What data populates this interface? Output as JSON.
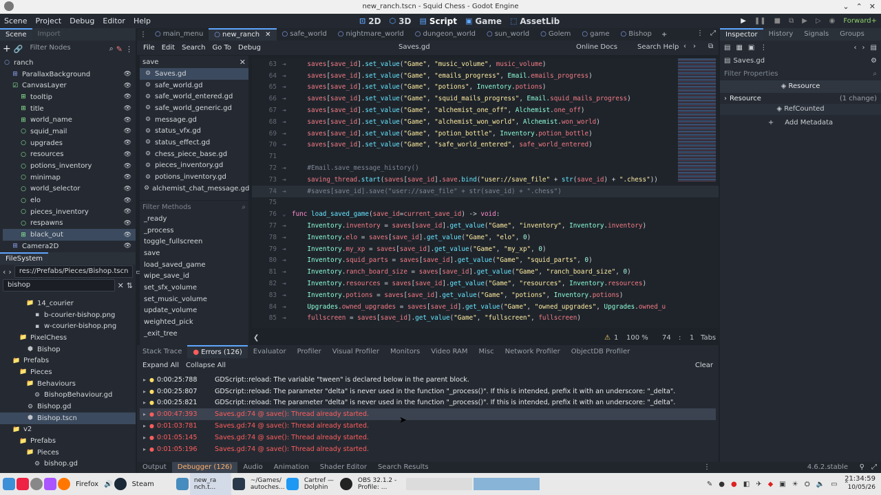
{
  "window": {
    "title": "new_ranch.tscn - Squid Chess - Godot Engine"
  },
  "menu": [
    "Scene",
    "Project",
    "Debug",
    "Editor",
    "Help"
  ],
  "workspaces": [
    {
      "label": "2D",
      "icon": "2d-icon"
    },
    {
      "label": "3D",
      "icon": "3d-icon"
    },
    {
      "label": "Script",
      "icon": "script-icon"
    },
    {
      "label": "Game",
      "icon": "game-icon"
    },
    {
      "label": "AssetLib",
      "icon": "assetlib-icon"
    }
  ],
  "renderer": "Forward+",
  "scene_dock": {
    "tabs": [
      "Scene",
      "Import"
    ],
    "filter_placeholder": "Filter Nodes",
    "nodes": [
      "ranch",
      "ParallaxBackground",
      "CanvasLayer",
      "tooltip",
      "title",
      "world_name",
      "squid_mail",
      "upgrades",
      "resources",
      "potions_inventory",
      "minimap",
      "world_selector",
      "elo",
      "pieces_inventory",
      "respawns",
      "black_out",
      "Camera2D"
    ]
  },
  "filesystem": {
    "tab": "FileSystem",
    "path": "res://Prefabs/Pieces/Bishop.tscn",
    "search": "bishop",
    "items": [
      "14_courier",
      "b-courier-bishop.png",
      "w-courier-bishop.png",
      "PixelChess",
      "Bishop",
      "Prefabs",
      "Pieces",
      "Behaviours",
      "BishopBehaviour.gd",
      "Bishop.gd",
      "Bishop.tscn",
      "v2",
      "Prefabs",
      "Pieces",
      "bishop.gd"
    ]
  },
  "scene_tabs": [
    "main_menu",
    "new_ranch",
    "safe_world",
    "nightmare_world",
    "dungeon_world",
    "sun_world",
    "Golem",
    "game",
    "Bishop"
  ],
  "script_menu": [
    "File",
    "Edit",
    "Search",
    "Go To",
    "Debug"
  ],
  "script_name": "Saves.gd",
  "online_docs": "Online Docs",
  "search_help": "Search Help",
  "script_filter": "save",
  "scripts": [
    "Saves.gd",
    "safe_world.gd",
    "safe_world_entered.gd",
    "safe_world_generic.gd",
    "message.gd",
    "status_vfx.gd",
    "status_effect.gd",
    "chess_piece_base.gd",
    "pieces_inventory.gd",
    "potions_inventory.gd",
    "alchemist_chat_message.gd"
  ],
  "methods_filter": "Filter Methods",
  "methods": [
    "_ready",
    "_process",
    "toggle_fullscreen",
    "save",
    "load_saved_game",
    "wipe_save_id",
    "set_sfx_volume",
    "set_music_volume",
    "update_volume",
    "weighted_pick",
    "_exit_tree"
  ],
  "code": {
    "lines": [
      {
        "n": "63",
        "t": "    saves[save_id].set_value(\"Game\", \"music_volume\", music_volume)"
      },
      {
        "n": "64",
        "t": "    saves[save_id].set_value(\"Game\", \"emails_progress\", Email.emails_progress)"
      },
      {
        "n": "65",
        "t": "    saves[save_id].set_value(\"Game\", \"potions\", Inventory.potions)"
      },
      {
        "n": "66",
        "t": "    saves[save_id].set_value(\"Game\", \"squid_mails_progress\", Email.squid_mails_progress)"
      },
      {
        "n": "67",
        "t": "    saves[save_id].set_value(\"Game\", \"alchemist_one_off\", Alchemist.one_off)"
      },
      {
        "n": "68",
        "t": "    saves[save_id].set_value(\"Game\", \"alchemist_won_world\", Alchemist.won_world)"
      },
      {
        "n": "69",
        "t": "    saves[save_id].set_value(\"Game\", \"potion_bottle\", Inventory.potion_bottle)"
      },
      {
        "n": "70",
        "t": "    saves[save_id].set_value(\"Game\", \"safe_world_entered\", safe_world_entered)"
      },
      {
        "n": "71",
        "t": ""
      },
      {
        "n": "72",
        "t": "    #Email.save_message_history()"
      },
      {
        "n": "73",
        "t": "    saving_thread.start(saves[save_id].save.bind(\"user://save_file\" + str(save_id) + \".chess\"))"
      },
      {
        "n": "74",
        "t": "    #saves[save_id].save(\"user://save_file\" + str(save_id) + \".chess\")"
      },
      {
        "n": "75",
        "t": ""
      },
      {
        "n": "76",
        "t": "func load_saved_game(save_id=current_save_id) -> void:"
      },
      {
        "n": "77",
        "t": "    Inventory.inventory = saves[save_id].get_value(\"Game\", \"inventory\", Inventory.inventory)"
      },
      {
        "n": "78",
        "t": "    Inventory.elo = saves[save_id].get_value(\"Game\", \"elo\", 0)"
      },
      {
        "n": "79",
        "t": "    Inventory.my_xp = saves[save_id].get_value(\"Game\", \"my_xp\", 0)"
      },
      {
        "n": "80",
        "t": "    Inventory.squid_parts = saves[save_id].get_value(\"Game\", \"squid_parts\", 0)"
      },
      {
        "n": "81",
        "t": "    Inventory.ranch_board_size = saves[save_id].get_value(\"Game\", \"ranch_board_size\", 0)"
      },
      {
        "n": "82",
        "t": "    Inventory.resources = saves[save_id].get_value(\"Game\", \"resources\", Inventory.resources)"
      },
      {
        "n": "83",
        "t": "    Inventory.potions = saves[save_id].get_value(\"Game\", \"potions\", Inventory.potions)"
      },
      {
        "n": "84",
        "t": "    Upgrades.owned_upgrades = saves[save_id].get_value(\"Game\", \"owned_upgrades\", Upgrades.owned_u"
      },
      {
        "n": "85",
        "t": "    fullscreen = saves[save_id].get_value(\"Game\", \"fullscreen\", fullscreen)"
      }
    ]
  },
  "status": {
    "warnings": "1",
    "zoom": "100 %",
    "line": "74",
    "col": "1",
    "indent": "Tabs"
  },
  "inspector": {
    "tabs": [
      "Inspector",
      "History",
      "Signals",
      "Groups"
    ],
    "object": "Saves.gd",
    "filter": "Filter Properties",
    "resource_header": "Resource",
    "resource_section": "Resource",
    "changes": "(1 change)",
    "refcounted": "RefCounted",
    "add_metadata": "Add Metadata"
  },
  "debugger": {
    "tabs": [
      "Stack Trace",
      "Errors (126)",
      "Evaluator",
      "Profiler",
      "Visual Profiler",
      "Monitors",
      "Video RAM",
      "Misc",
      "Network Profiler",
      "ObjectDB Profiler"
    ],
    "expand_all": "Expand All",
    "collapse_all": "Collapse All",
    "clear": "Clear",
    "errors": [
      {
        "time": "0:00:25:788",
        "msg": "GDScript::reload: The variable \"tween\" is declared below in the parent block.",
        "level": "warning"
      },
      {
        "time": "0:00:25:807",
        "msg": "GDScript::reload: The parameter \"delta\" is never used in the function \"_process()\". If this is intended, prefix it with an underscore: \"_delta\".",
        "level": "warning"
      },
      {
        "time": "0:00:25:821",
        "msg": "GDScript::reload: The parameter \"delta\" is never used in the function \"_process()\". If this is intended, prefix it with an underscore: \"_delta\".",
        "level": "warning"
      },
      {
        "time": "0:00:47:393",
        "msg": "Saves.gd:74 @ save(): Thread already started.",
        "level": "error"
      },
      {
        "time": "0:01:03:781",
        "msg": "Saves.gd:74 @ save(): Thread already started.",
        "level": "error"
      },
      {
        "time": "0:01:05:145",
        "msg": "Saves.gd:74 @ save(): Thread already started.",
        "level": "error"
      },
      {
        "time": "0:01:05:196",
        "msg": "Saves.gd:74 @ save(): Thread already started.",
        "level": "error"
      }
    ]
  },
  "bottom_tabs": [
    "Output",
    "Debugger (126)",
    "Audio",
    "Animation",
    "Shader Editor",
    "Search Results"
  ],
  "version": "4.6.2.stable",
  "taskbar": {
    "items": [
      "Firefox",
      "Steam",
      "new_ra nch.t...",
      "~/Games/ autoches...",
      "Cartref — Dolphin",
      "OBS 32.1.2 - Profile: ..."
    ],
    "time": "21:34:59",
    "date": "10/05/26"
  },
  "colors": {
    "accent": "#5fa7ff",
    "error": "#ff5d5d",
    "warning": "#ffdd65"
  }
}
